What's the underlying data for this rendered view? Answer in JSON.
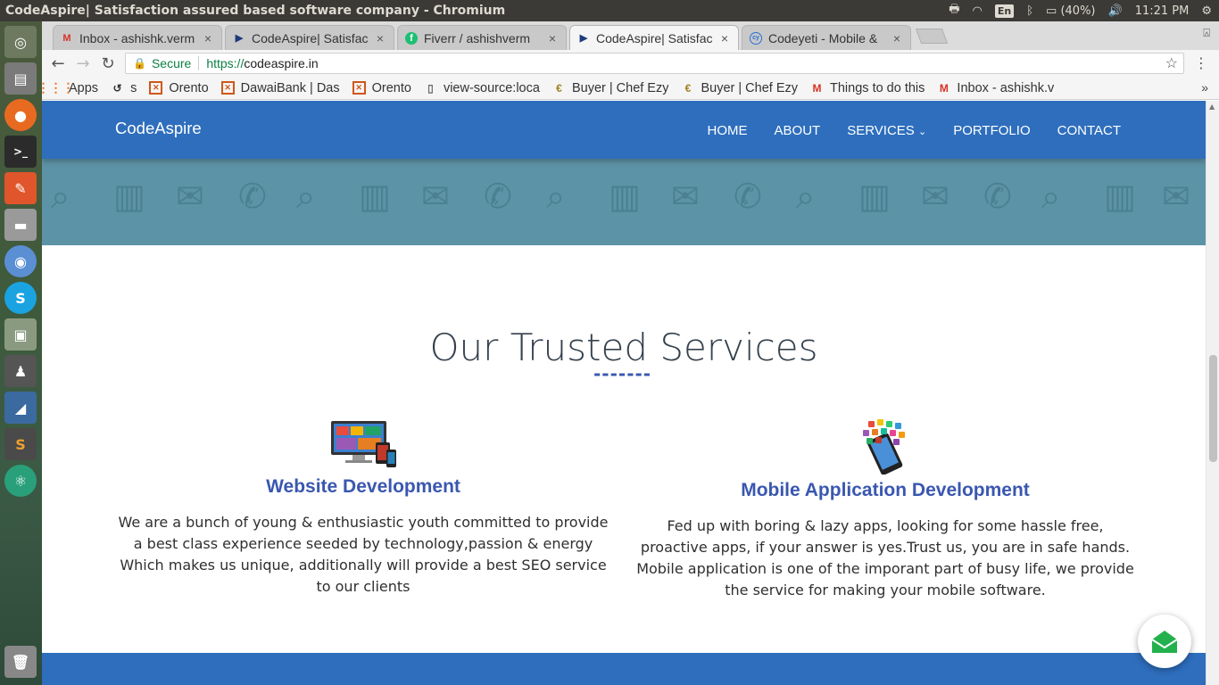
{
  "os": {
    "window_title": "CodeAspire| Satisfaction assured based software company - Chromium",
    "lang": "En",
    "battery": "(40%)",
    "clock": "11:21 PM"
  },
  "tabs": [
    {
      "title": "Inbox - ashishk.verm",
      "icon": "gmail-icon"
    },
    {
      "title": "CodeAspire| Satisfac",
      "icon": "codeaspire-icon"
    },
    {
      "title": "Fiverr / ashishverm",
      "icon": "fiverr-icon"
    },
    {
      "title": "CodeAspire| Satisfac",
      "icon": "codeaspire-icon",
      "active": true
    },
    {
      "title": "Codeyeti - Mobile &",
      "icon": "codeyeti-icon"
    }
  ],
  "toolbar": {
    "secure_label": "Secure",
    "url_scheme": "https://",
    "url_host": "codeaspire.in"
  },
  "bookmarks": [
    {
      "label": "Apps",
      "icon": "apps-grid-icon"
    },
    {
      "label": "s",
      "icon": "history-icon"
    },
    {
      "label": "Orento",
      "icon": "orento-icon"
    },
    {
      "label": "DawaiBank | Das",
      "icon": "orento-icon"
    },
    {
      "label": "Orento",
      "icon": "orento-icon"
    },
    {
      "label": "view-source:loca",
      "icon": "page-icon"
    },
    {
      "label": "Buyer | Chef Ezy",
      "icon": "chefezy-icon"
    },
    {
      "label": "Buyer | Chef Ezy",
      "icon": "chefezy-icon"
    },
    {
      "label": "Things to do this",
      "icon": "gmail-icon"
    },
    {
      "label": "Inbox - ashishk.v",
      "icon": "gmail-icon"
    }
  ],
  "site": {
    "brand": "CodeAspire",
    "nav": [
      "HOME",
      "ABOUT",
      "SERVICES",
      "PORTFOLIO",
      "CONTACT"
    ],
    "section_title": "Our Trusted Services",
    "divider": "-------",
    "services": [
      {
        "title": "Website Development",
        "desc": "We are a bunch of young & enthusiastic youth committed to provide a best class experience seeded by technology,passion & energy Which makes us unique, additionally will provide a best SEO service to our clients"
      },
      {
        "title": "Mobile Application Development",
        "desc": "Fed up with boring & lazy apps, looking for some hassle free, proactive apps, if your answer is yes.Trust us, you are in safe hands. Mobile application is one of the imporant part of busy life, we provide the service for making your mobile software."
      }
    ]
  },
  "colors": {
    "navbar": "#2e6ebd",
    "accent": "#3a57b0",
    "hero": "#5d93a6"
  }
}
